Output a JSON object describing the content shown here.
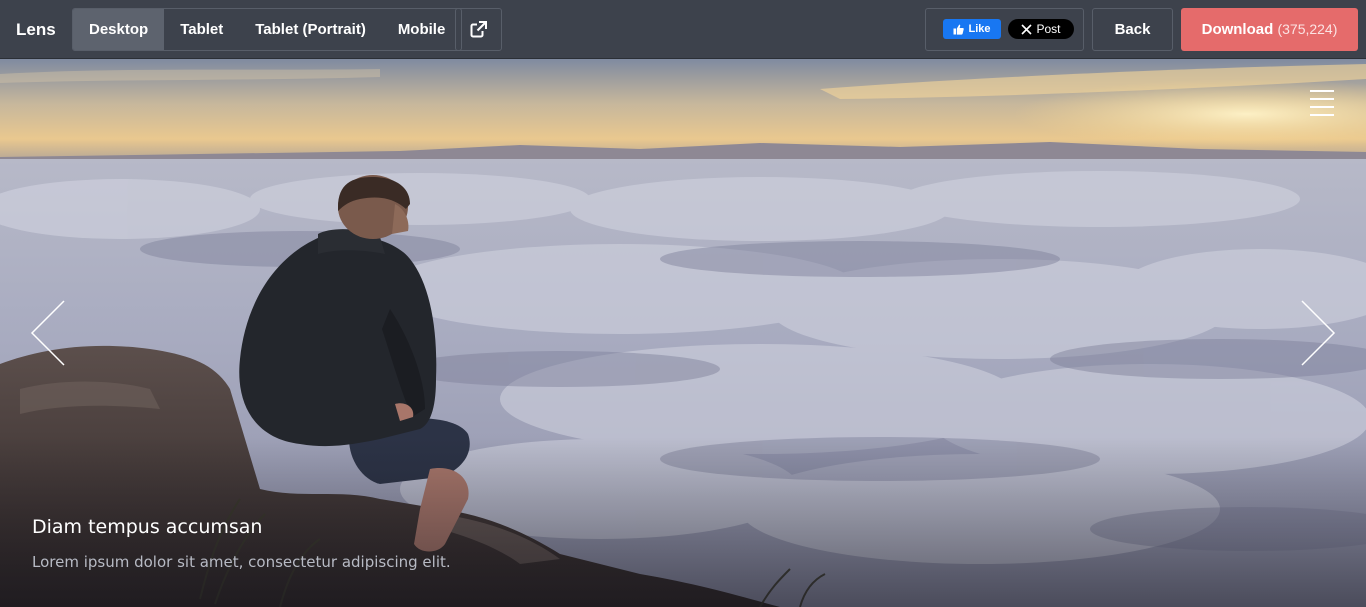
{
  "topbar": {
    "brand": "Lens",
    "devices": [
      {
        "label": "Desktop",
        "active": true
      },
      {
        "label": "Tablet",
        "active": false
      },
      {
        "label": "Tablet (Portrait)",
        "active": false
      },
      {
        "label": "Mobile",
        "active": false
      }
    ],
    "external_icon": "external-link-icon",
    "social": {
      "like_label": "Like",
      "post_label": "Post"
    },
    "back_label": "Back",
    "download_label": "Download",
    "download_count": "(375,224)"
  },
  "hero": {
    "caption_title": "Diam tempus accumsan",
    "caption_text": "Lorem ipsum dolor sit amet, consectetur adipiscing elit.",
    "menu_icon": "hamburger-menu-icon",
    "prev_icon": "chevron-left-icon",
    "next_icon": "chevron-right-icon"
  },
  "colors": {
    "topbar_bg": "#3d424c",
    "active_tab": "#5d636e",
    "download_bg": "#e56b6b",
    "facebook_blue": "#1877f2"
  }
}
